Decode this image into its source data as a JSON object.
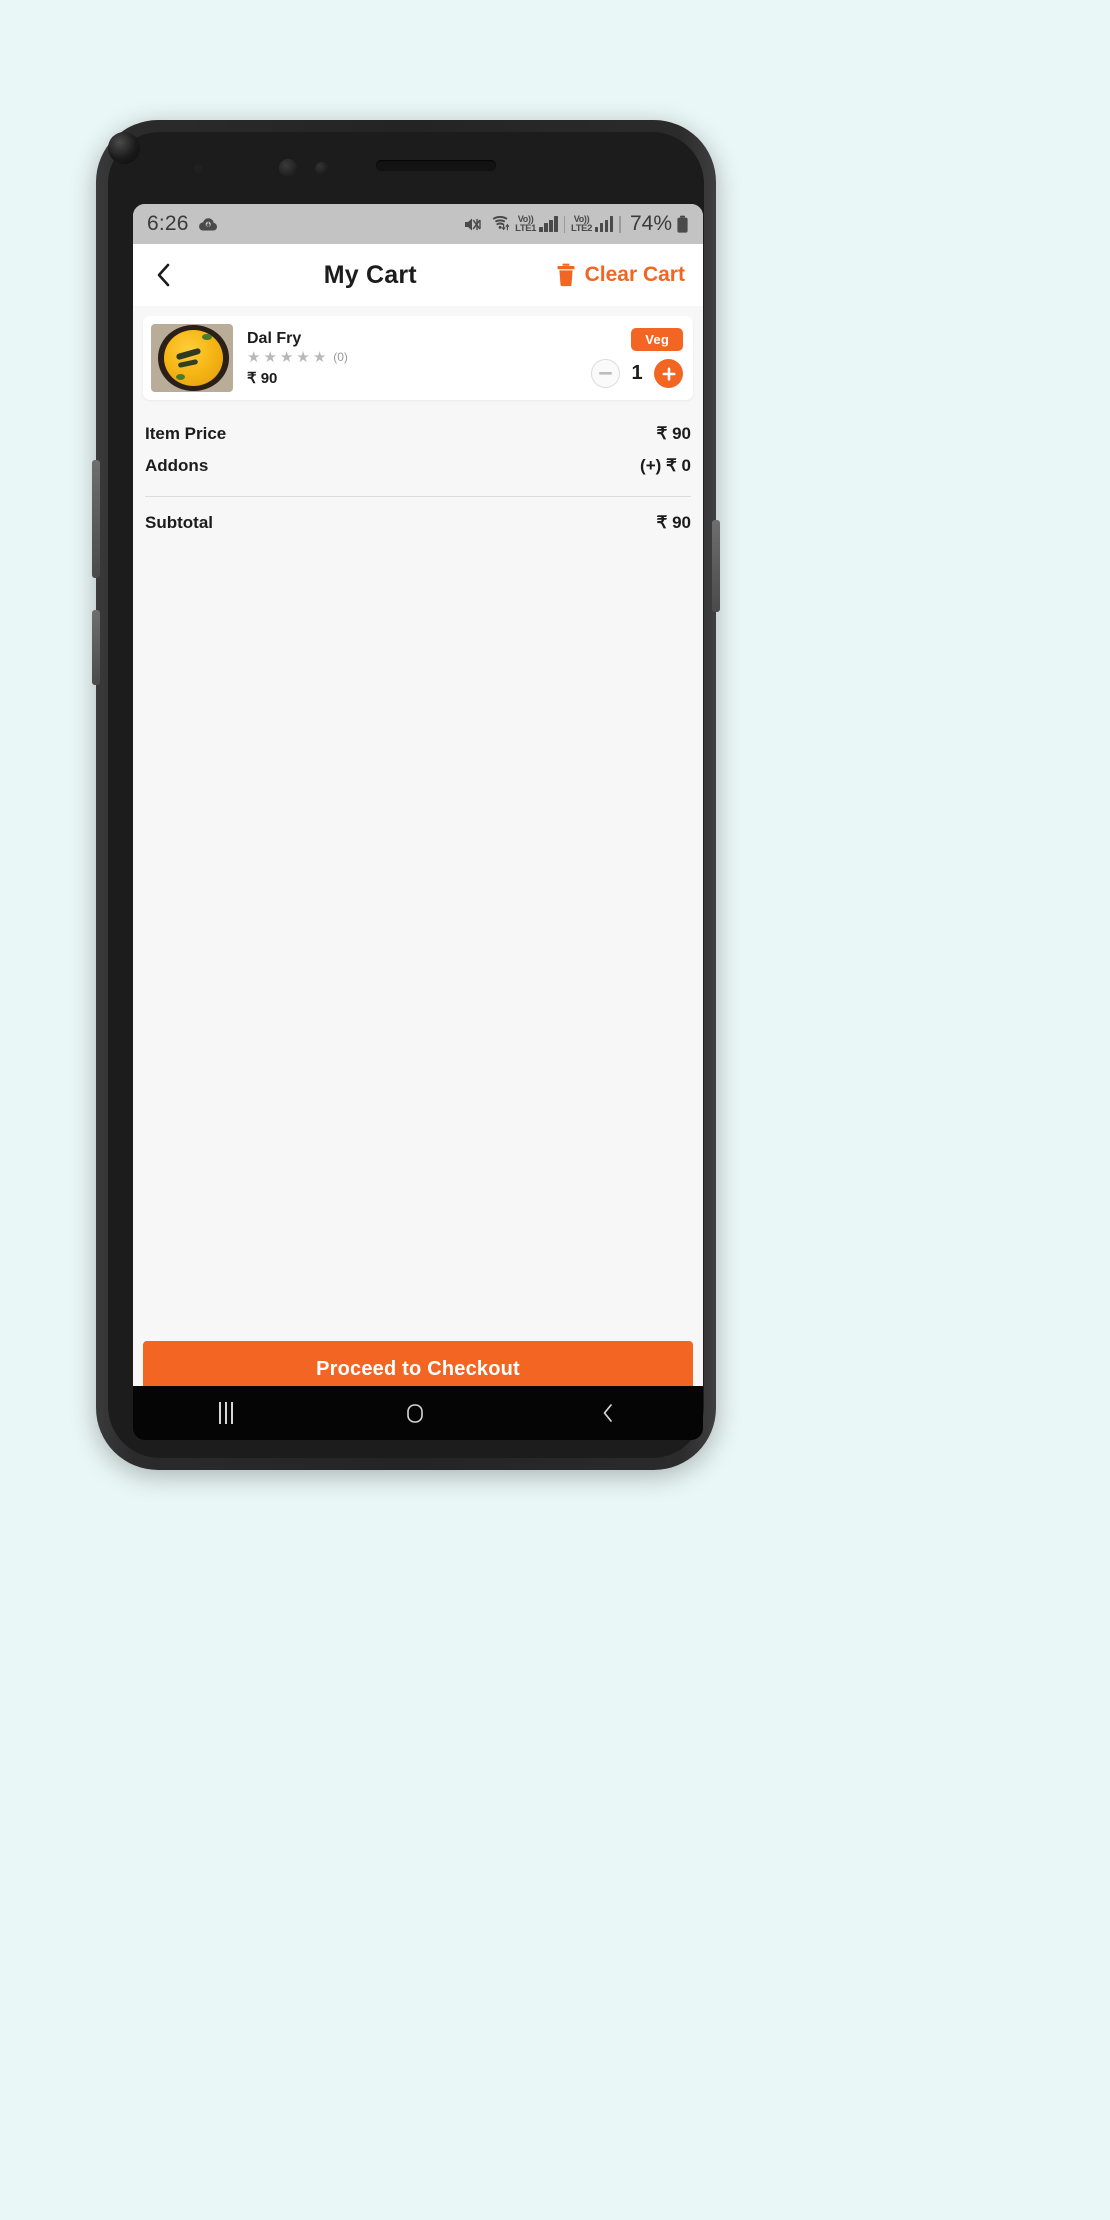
{
  "background_color": "#eaf7f7",
  "accent_color": "#f26522",
  "status_bar": {
    "time": "6:26",
    "cloud_icon": "cloud-download-icon",
    "mute_icon": "volume-mute-icon",
    "wifi_icon": "wifi-icon",
    "sim1_label_top": "Vo))",
    "sim1_label_bottom": "LTE1",
    "sim2_label_top": "Vo))",
    "sim2_label_bottom": "LTE2",
    "battery_percent": "74%",
    "battery_icon": "battery-icon"
  },
  "appbar": {
    "back_icon": "chevron-left-icon",
    "title": "My Cart",
    "clear_cart_label": "Clear Cart",
    "clear_cart_icon": "trash-icon"
  },
  "cart": {
    "items": [
      {
        "name": "Dal Fry",
        "image_alt": "dal-fry-photo",
        "stars": [
          "★",
          "★",
          "★",
          "★",
          "★"
        ],
        "rating_count": "(0)",
        "price": "₹ 90",
        "badge": "Veg",
        "quantity": "1",
        "decrement_icon": "minus-icon",
        "increment_icon": "plus-icon"
      }
    ]
  },
  "summary": {
    "rows": [
      {
        "label": "Item Price",
        "value": "₹ 90"
      },
      {
        "label": "Addons",
        "value": "(+) ₹ 0"
      }
    ],
    "total": {
      "label": "Subtotal",
      "value": "₹ 90"
    }
  },
  "checkout": {
    "label": "Proceed to Checkout"
  },
  "navigation_bar": {
    "recents_icon": "recent-apps-icon",
    "home_icon": "home-icon",
    "back_icon": "back-icon"
  }
}
